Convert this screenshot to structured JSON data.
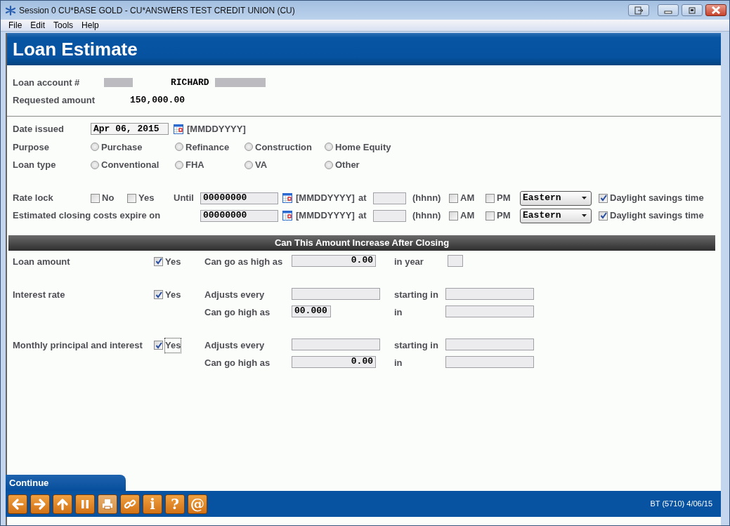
{
  "window": {
    "title": "Session 0 CU*BASE GOLD - CU*ANSWERS TEST CREDIT UNION (CU)"
  },
  "menu": [
    "File",
    "Edit",
    "Tools",
    "Help"
  ],
  "header": {
    "title": "Loan Estimate"
  },
  "account": {
    "label": "Loan account #",
    "name": "RICHARD"
  },
  "requested": {
    "label": "Requested amount",
    "value": "150,000.00"
  },
  "date_issued": {
    "label": "Date issued",
    "value": "Apr 06, 2015",
    "format": "[MMDDYYYY]"
  },
  "choices": [
    {
      "label": "Purpose",
      "options": [
        {
          "label": "Purchase",
          "selected": false
        },
        {
          "label": "Refinance",
          "selected": false
        },
        {
          "label": "Construction",
          "selected": false
        },
        {
          "label": "Home Equity",
          "selected": false
        }
      ]
    },
    {
      "label": "Loan type",
      "options": [
        {
          "label": "Conventional",
          "selected": false
        },
        {
          "label": "FHA",
          "selected": false
        },
        {
          "label": "VA",
          "selected": false
        },
        {
          "label": "Other",
          "selected": false
        }
      ]
    }
  ],
  "time_rows": [
    {
      "label": "Rate lock",
      "options": [
        {
          "label": "No",
          "checked": false
        },
        {
          "label": "Yes",
          "checked": false
        }
      ],
      "until": "Until",
      "date": "00000000",
      "format": "[MMDDYYYY]",
      "at": "at",
      "time_format": "(hhnn)",
      "am": {
        "label": "AM",
        "checked": false
      },
      "pm": {
        "label": "PM",
        "checked": false
      },
      "timezone": "Eastern",
      "dst": {
        "label": "Daylight savings time",
        "checked": true
      }
    },
    {
      "label": "Estimated closing costs expire on",
      "date": "00000000",
      "format": "[MMDDYYYY]",
      "at": "at",
      "time_format": "(hhnn)",
      "am": {
        "label": "AM",
        "checked": false
      },
      "pm": {
        "label": "PM",
        "checked": false
      },
      "timezone": "Eastern",
      "dst": {
        "label": "Daylight savings time",
        "checked": true
      }
    }
  ],
  "section_title": "Can This Amount Increase After Closing",
  "increase": [
    {
      "label": "Loan amount",
      "yes": {
        "label": "Yes",
        "checked": true,
        "focused": false
      },
      "lines": [
        {
          "label": "Can go as high as",
          "field": {
            "kind": "amount",
            "value": "0.00"
          },
          "label2": "in year",
          "field2": {
            "kind": "year"
          }
        }
      ]
    },
    {
      "label": "Interest rate",
      "yes": {
        "label": "Yes",
        "checked": true,
        "focused": false
      },
      "lines": [
        {
          "label": "Adjusts every",
          "field": {
            "kind": "wide"
          },
          "label2": "starting in",
          "field2": {
            "kind": "wide"
          }
        },
        {
          "label": "Can go high as",
          "field": {
            "kind": "rate",
            "value": "00.000"
          },
          "label2": "in",
          "field2": {
            "kind": "wide"
          }
        }
      ]
    },
    {
      "label": "Monthly principal and interest",
      "yes": {
        "label": "Yes",
        "checked": true,
        "focused": true
      },
      "lines": [
        {
          "label": "Adjusts every",
          "field": {
            "kind": "wide"
          },
          "label2": "starting in",
          "field2": {
            "kind": "wide"
          }
        },
        {
          "label": "Can go high as",
          "field": {
            "kind": "amount",
            "value": "0.00"
          },
          "label2": "in",
          "field2": {
            "kind": "wide"
          }
        }
      ]
    }
  ],
  "continue": "Continue",
  "toolbar": [
    {
      "kind": "back",
      "disabled": false
    },
    {
      "kind": "forward",
      "disabled": false
    },
    {
      "kind": "up",
      "disabled": false
    },
    {
      "kind": "pause",
      "disabled": false
    },
    {
      "kind": "print",
      "disabled": true
    },
    {
      "kind": "link",
      "disabled": false
    },
    {
      "kind": "char",
      "symbol": "i",
      "disabled": false
    },
    {
      "kind": "char",
      "symbol": "?",
      "disabled": false
    },
    {
      "kind": "char",
      "symbol": "@",
      "disabled": false
    }
  ],
  "status": "BT (5710) 4/06/15"
}
